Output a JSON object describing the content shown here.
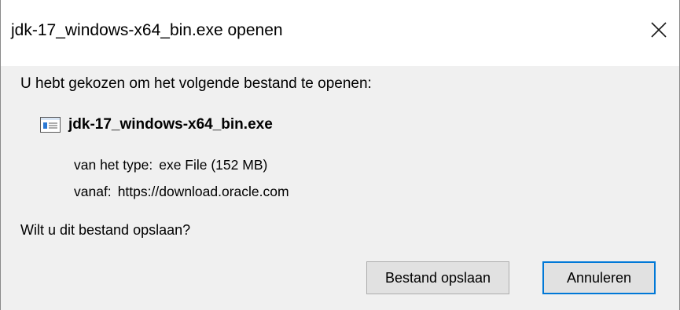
{
  "window": {
    "title": "jdk-17_windows-x64_bin.exe openen",
    "close_icon": "close-x-icon"
  },
  "dialog": {
    "intro_text": "U hebt gekozen om het volgende bestand te openen:",
    "file": {
      "name": "jdk-17_windows-x64_bin.exe",
      "icon": "executable-window-icon",
      "type_label": "van het type:",
      "type_value": "exe File (152 MB)",
      "from_label": "vanaf:",
      "from_value": "https://download.oracle.com"
    },
    "question": "Wilt u dit bestand opslaan?",
    "buttons": {
      "save_label": "Bestand opslaan",
      "cancel_label": "Annuleren"
    }
  },
  "colors": {
    "title_bar": "#ffffff",
    "content_background": "#f0f0f0",
    "button_background": "#e1e1e1",
    "button_border": "#adadad",
    "focus_border": "#0078d7",
    "file_icon_accent": "#2b79d4"
  }
}
